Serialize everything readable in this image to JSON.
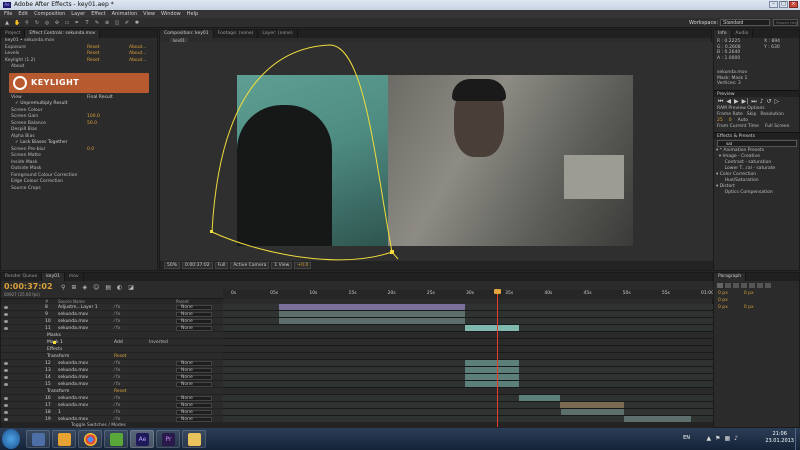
{
  "titlebar": {
    "title": "Adobe After Effects - key01.aep *"
  },
  "menu": [
    "File",
    "Edit",
    "Composition",
    "Layer",
    "Effect",
    "Animation",
    "View",
    "Window",
    "Help"
  ],
  "workspace": {
    "label": "Workspace:",
    "value": "Standard",
    "search_placeholder": "Search Help"
  },
  "left_panel": {
    "tabs": [
      "Project",
      "Effect Controls: sekunda.mov"
    ],
    "breadcrumb": "key01 • sekunda.mov",
    "effects": [
      {
        "name": "Exposure",
        "reset": "Reset",
        "about": "About..."
      },
      {
        "name": "Levels",
        "reset": "Reset",
        "about": "About..."
      },
      {
        "name": "Keylight (1.2)",
        "reset": "Reset",
        "about": "About..."
      }
    ],
    "about_label": "About",
    "logo_text": "KEYLIGHT",
    "params": [
      {
        "name": "View",
        "value": "Final Result"
      },
      {
        "name": "",
        "value": "✓ Unpremultiply Result"
      },
      {
        "name": "Screen Colour",
        "value": ""
      },
      {
        "name": "Screen Gain",
        "value": "100.0"
      },
      {
        "name": "Screen Balance",
        "value": "50.0"
      },
      {
        "name": "Despill Bias",
        "value": ""
      },
      {
        "name": "Alpha Bias",
        "value": ""
      },
      {
        "name": "",
        "value": "✓ Lock Biases Together"
      },
      {
        "name": "Screen Pre-blur",
        "value": "0.0"
      },
      {
        "name": "Screen Matte",
        "value": ""
      },
      {
        "name": "Inside Mask",
        "value": ""
      },
      {
        "name": "Outside Mask",
        "value": ""
      },
      {
        "name": "Foreground Colour Correction",
        "value": ""
      },
      {
        "name": "Edge Colour Correction",
        "value": ""
      },
      {
        "name": "Source Crops",
        "value": ""
      }
    ]
  },
  "comp_panel": {
    "tabs": [
      "Composition: key01",
      "Footage: (none)",
      "Layer: (none)"
    ],
    "comp_tab": "key01",
    "viewer_bar": [
      "50%",
      "0:00:37:02",
      "Full",
      "Active Camera",
      "1 View",
      "+0.0"
    ]
  },
  "right_panel": {
    "info_tabs": [
      "Info",
      "Audio"
    ],
    "info": [
      "R : 0.2225",
      "G : 0.2608",
      "B : 0.2640",
      "A : 1.0000",
      "X : 894",
      "Y : 630"
    ],
    "info_file": "sekunda.mov",
    "info_mask": "Mask: Mask 1",
    "info_vertices": "Vertices: 3",
    "preview_label": "Preview",
    "ram_options": "RAM Preview Options",
    "frame_rate_label": "Frame Rate",
    "skip_label": "Skip",
    "resolution_label": "Resolution",
    "frame_rate": "25",
    "skip": "0",
    "resolution": "Auto",
    "from_current": "From Current Time",
    "full_screen": "Full Screen",
    "effects_title": "Effects & Presets",
    "effects_search": "sat",
    "tree": [
      "▾ * Animation Presets",
      "  ▾ Image - Creative",
      "      Contrast - saturation",
      "      Lower T...ral - saturate",
      "▾ Color Correction",
      "      Hue/Saturation",
      "▾ Distort",
      "      Optics Compensation"
    ],
    "paragraph_title": "Paragraph",
    "para_vals": [
      "0 px",
      "0 px",
      "0 px",
      "0 px",
      "0 px"
    ]
  },
  "timeline": {
    "tabs": [
      "Render Queue",
      "key01",
      "mov"
    ],
    "timecode": "0:00:37:02",
    "timecode_sub": "00927 (25.00 fps)",
    "col_headers": [
      "#",
      "Source Name",
      "Parent"
    ],
    "ruler_ticks": [
      "0s",
      "05s",
      "10s",
      "15s",
      "20s",
      "25s",
      "30s",
      "35s",
      "40s",
      "45s",
      "50s",
      "55s",
      "01:00s"
    ],
    "layers": [
      {
        "num": "8",
        "name": "Adjustm...Layer 1",
        "parent": "None"
      },
      {
        "num": "9",
        "name": "sekunda.mov",
        "parent": "None"
      },
      {
        "num": "10",
        "name": "sekunda.mov",
        "parent": "None"
      },
      {
        "num": "11",
        "name": "sekunda.mov",
        "parent": "None"
      },
      {
        "num": "",
        "name": "Masks",
        "parent": ""
      },
      {
        "num": "",
        "name": "Mask 1",
        "parent": "Add"
      },
      {
        "num": "",
        "name": "Effects",
        "parent": ""
      },
      {
        "num": "",
        "name": "Transform",
        "parent": "Reset"
      },
      {
        "num": "12",
        "name": "sekunda.mov",
        "parent": "None"
      },
      {
        "num": "13",
        "name": "sekunda.mov",
        "parent": "None"
      },
      {
        "num": "14",
        "name": "sekunda.mov",
        "parent": "None"
      },
      {
        "num": "15",
        "name": "sekunda.mov",
        "parent": "None"
      },
      {
        "num": "",
        "name": "Transform",
        "parent": "Reset"
      },
      {
        "num": "16",
        "name": "sekunda.mov",
        "parent": "None"
      },
      {
        "num": "17",
        "name": "sekunda.mov",
        "parent": "None"
      },
      {
        "num": "18",
        "name": "1",
        "parent": "None"
      },
      {
        "num": "19",
        "name": "sekunda.mov",
        "parent": "None"
      }
    ],
    "inverted_label": "Inverted",
    "footer": "Toggle Switches / Modes"
  },
  "taskbar": {
    "lang": "EN",
    "time": "21:06",
    "date": "23.01.2013",
    "apps": [
      "windows-media-icon",
      "chrome-icon",
      "torrent-icon",
      "after-effects-icon",
      "premiere-icon",
      "explorer-icon"
    ]
  },
  "colors": {
    "accent": "#d8a03a",
    "playhead": "#e23d2d",
    "mask": "#f0dc3c",
    "keylight": "#b85a2f"
  }
}
